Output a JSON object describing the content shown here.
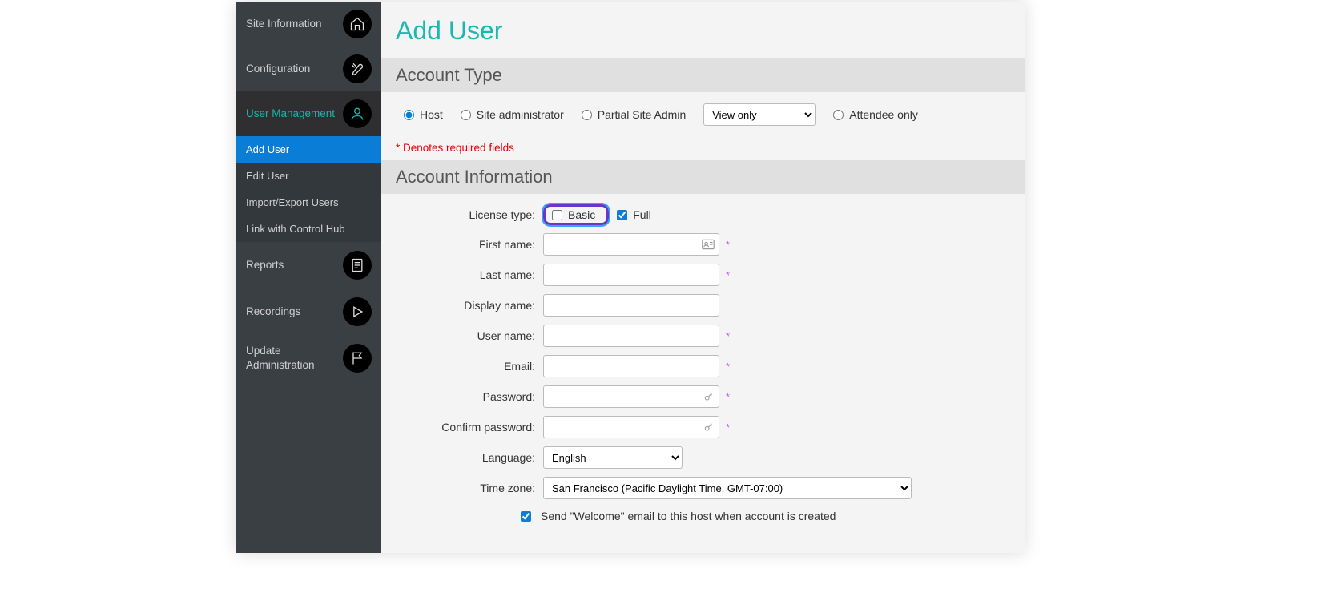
{
  "sidebar": {
    "site_information": "Site Information",
    "configuration": "Configuration",
    "user_management": "User Management",
    "reports": "Reports",
    "recordings": "Recordings",
    "update_administration": "Update Administration",
    "sub": {
      "add_user": "Add User",
      "edit_user": "Edit User",
      "import_export": "Import/Export Users",
      "link_control_hub": "Link with Control Hub"
    }
  },
  "page": {
    "title": "Add User"
  },
  "account_type": {
    "header": "Account Type",
    "host": "Host",
    "site_admin": "Site administrator",
    "partial_admin": "Partial Site Admin",
    "partial_select": "View only",
    "attendee_only": "Attendee only"
  },
  "required_note": "* Denotes required fields",
  "account_info": {
    "header": "Account Information",
    "license_label": "License type:",
    "basic": "Basic",
    "full": "Full",
    "first_name": "First name:",
    "last_name": "Last name:",
    "display_name": "Display name:",
    "user_name": "User name:",
    "email": "Email:",
    "password": "Password:",
    "confirm_password": "Confirm password:",
    "language": "Language:",
    "language_value": "English",
    "time_zone": "Time zone:",
    "time_zone_value": "San Francisco (Pacific Daylight Time, GMT-07:00)",
    "welcome_label": "Send \"Welcome\" email to this host when account is created"
  }
}
